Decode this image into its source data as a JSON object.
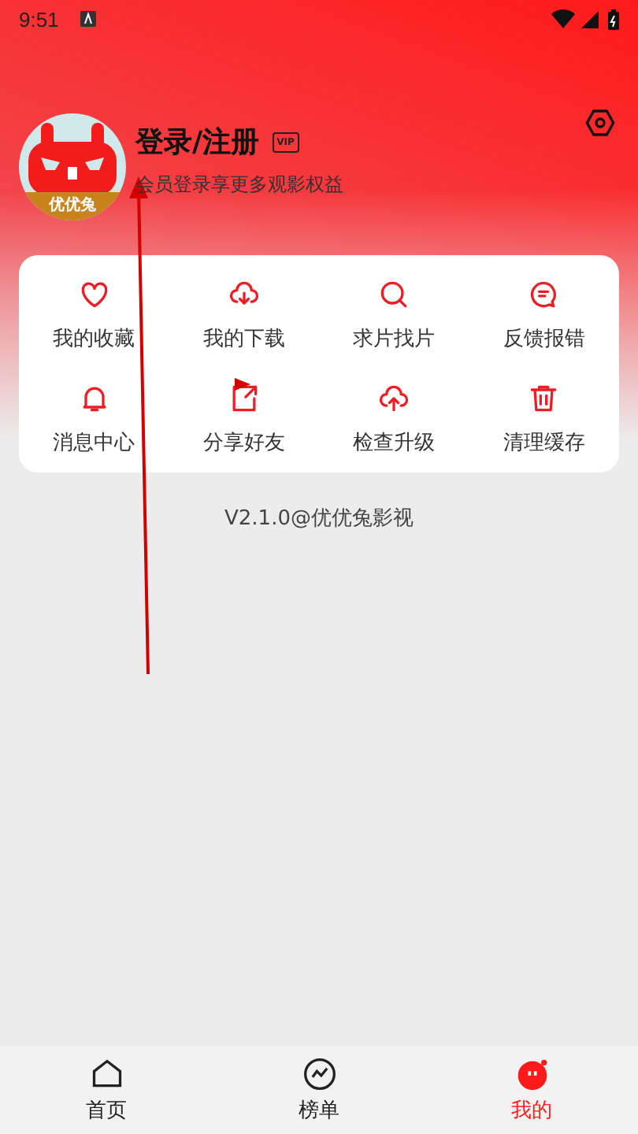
{
  "status_bar": {
    "time": "9:51"
  },
  "profile": {
    "avatar_caption": "优优兔",
    "title": "登录/注册",
    "badge": "VIP",
    "subtitle": "会员登录享更多观影权益"
  },
  "menu": [
    {
      "label": "我的收藏"
    },
    {
      "label": "我的下载"
    },
    {
      "label": "求片找片"
    },
    {
      "label": "反馈报错"
    },
    {
      "label": "消息中心"
    },
    {
      "label": "分享好友"
    },
    {
      "label": "检查升级"
    },
    {
      "label": "清理缓存"
    }
  ],
  "version": "V2.1.0@优优兔影视",
  "bottom_nav": [
    {
      "label": "首页",
      "selected": false
    },
    {
      "label": "榜单",
      "selected": false
    },
    {
      "label": "我的",
      "selected": true
    }
  ]
}
